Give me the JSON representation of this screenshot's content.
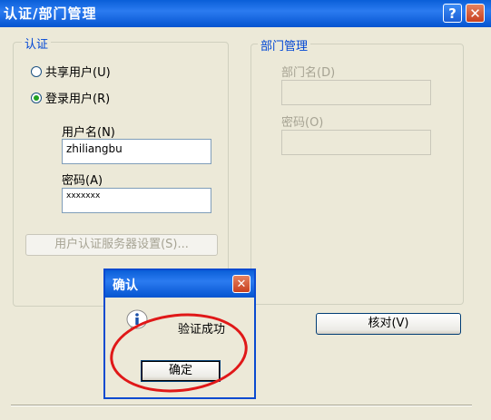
{
  "window": {
    "title": "认证/部门管理",
    "help_glyph": "?",
    "close_glyph": "✕"
  },
  "auth_group": {
    "legend": "认证",
    "radio_shared": "共享用户(U)",
    "radio_login": "登录用户(R)",
    "selected": "登录用户(R)",
    "username_label": "用户名(N)",
    "username_value": "zhiliangbu",
    "password_label": "密码(A)",
    "password_value": "xxxxxxx",
    "server_button": "用户认证服务器设置(S)..."
  },
  "dept_group": {
    "legend": "部门管理",
    "dept_name_label": "部门名(D)",
    "dept_password_label": "密码(O)",
    "verify_button": "核对(V)"
  },
  "dialog": {
    "title": "确认",
    "close_glyph": "✕",
    "icon": "info-icon",
    "message": "验证成功",
    "ok_button": "确定"
  },
  "colors": {
    "titlebar": "#0a5fd8",
    "legend": "#0046d5",
    "annotation_circle": "#e01818"
  }
}
